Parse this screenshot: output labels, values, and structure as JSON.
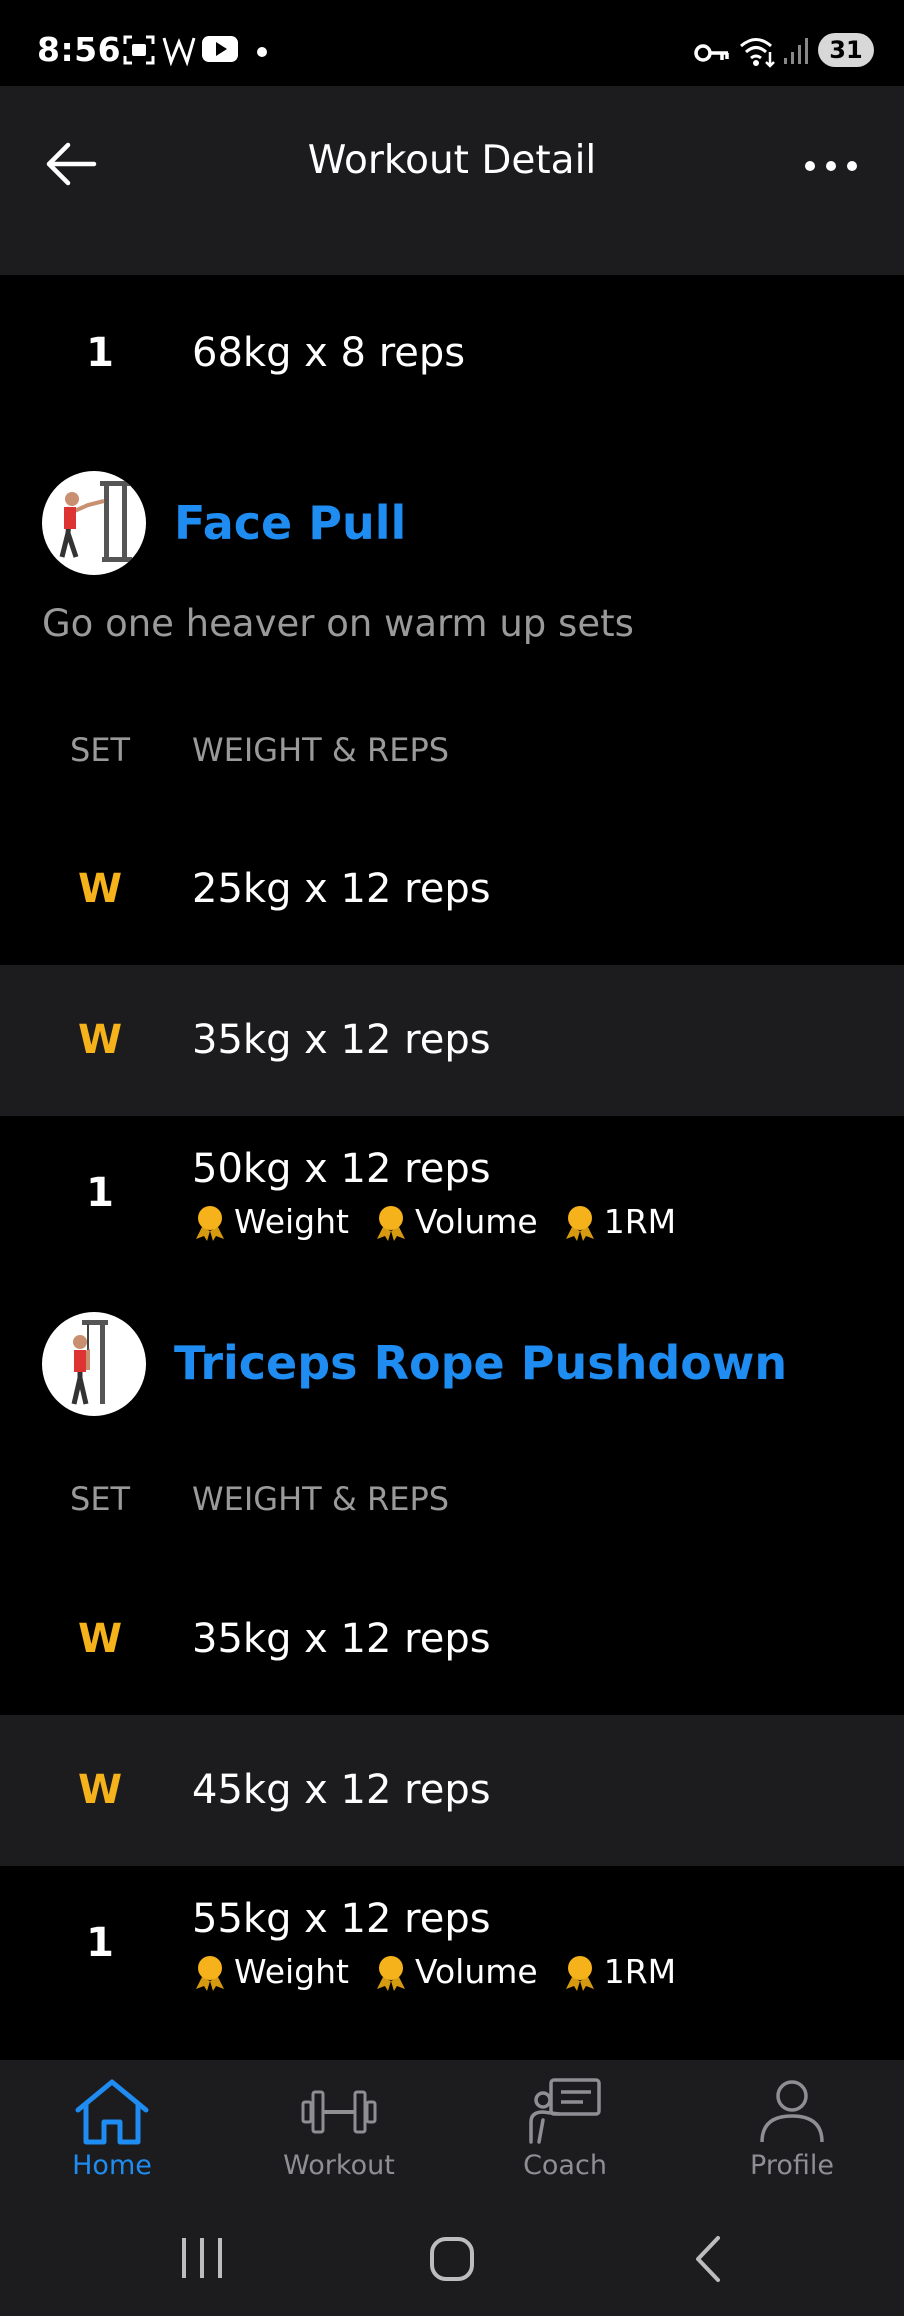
{
  "status_bar": {
    "time": "8:56",
    "battery": "31",
    "icons": [
      "screenshot-icon",
      "w-app-icon",
      "youtube-icon",
      "dot-icon",
      "vpn-key-icon",
      "wifi-icon",
      "signal-icon"
    ]
  },
  "header": {
    "title": "Workout Detail"
  },
  "previous_exercise": {
    "sets": [
      {
        "set": "1",
        "weight_reps": "68kg x 8 reps"
      }
    ]
  },
  "exercises": [
    {
      "name": "Face Pull",
      "note": "Go one heaver on warm up sets",
      "col_set": "SET",
      "col_weight_reps": "WEIGHT & REPS",
      "sets": [
        {
          "set": "W",
          "weight_reps": "25kg x 12 reps"
        },
        {
          "set": "W",
          "weight_reps": "35kg x 12 reps"
        },
        {
          "set": "1",
          "weight_reps": "50kg x 12 reps",
          "prs": [
            "Weight",
            "Volume",
            "1RM"
          ]
        }
      ]
    },
    {
      "name": "Triceps Rope Pushdown",
      "col_set": "SET",
      "col_weight_reps": "WEIGHT & REPS",
      "sets": [
        {
          "set": "W",
          "weight_reps": "35kg x 12 reps"
        },
        {
          "set": "W",
          "weight_reps": "45kg x 12 reps"
        },
        {
          "set": "1",
          "weight_reps": "55kg x 12 reps",
          "prs": [
            "Weight",
            "Volume",
            "1RM"
          ]
        }
      ]
    }
  ],
  "bottom_nav": [
    {
      "label": "Home",
      "icon": "home-icon",
      "active": true
    },
    {
      "label": "Workout",
      "icon": "dumbbell-icon",
      "active": false
    },
    {
      "label": "Coach",
      "icon": "coach-icon",
      "active": false
    },
    {
      "label": "Profile",
      "icon": "profile-icon",
      "active": false
    }
  ],
  "colors": {
    "accent": "#1e8cf0",
    "warmup": "#f5b21b",
    "medal": "#f5b21b",
    "surface": "#1c1c1e"
  }
}
